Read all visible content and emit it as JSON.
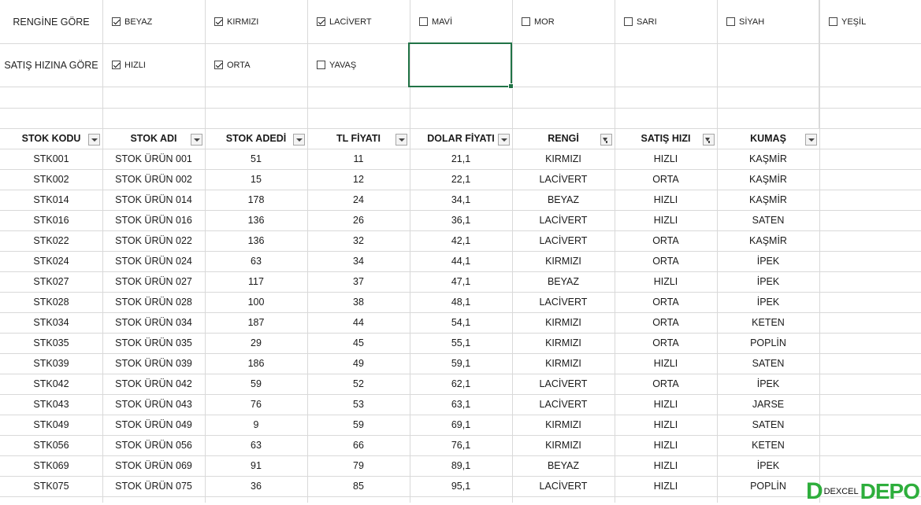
{
  "slicers": {
    "color": {
      "label": "RENGİNE GÖRE",
      "options": [
        {
          "label": "BEYAZ",
          "checked": true
        },
        {
          "label": "KIRMIZI",
          "checked": true
        },
        {
          "label": "LACİVERT",
          "checked": true
        },
        {
          "label": "MAVİ",
          "checked": false
        },
        {
          "label": "MOR",
          "checked": false
        },
        {
          "label": "SARI",
          "checked": false
        },
        {
          "label": "SİYAH",
          "checked": false
        },
        {
          "label": "YEŞİL",
          "checked": false
        }
      ]
    },
    "speed": {
      "label": "SATIŞ HIZINA GÖRE",
      "options": [
        {
          "label": "HIZLI",
          "checked": true
        },
        {
          "label": "ORTA",
          "checked": true
        },
        {
          "label": "YAVAŞ",
          "checked": false
        }
      ]
    }
  },
  "table": {
    "headers": [
      {
        "label": "STOK KODU",
        "filtered": false
      },
      {
        "label": "STOK ADI",
        "filtered": false
      },
      {
        "label": "STOK ADEDİ",
        "filtered": false
      },
      {
        "label": "TL FİYATI",
        "filtered": false
      },
      {
        "label": "DOLAR FİYATI",
        "filtered": false
      },
      {
        "label": "RENGİ",
        "filtered": true
      },
      {
        "label": "SATIŞ HIZI",
        "filtered": true
      },
      {
        "label": "KUMAŞ",
        "filtered": false
      }
    ],
    "rows": [
      [
        "STK001",
        "STOK ÜRÜN 001",
        "51",
        "11",
        "21,1",
        "KIRMIZI",
        "HIZLI",
        "KAŞMİR"
      ],
      [
        "STK002",
        "STOK ÜRÜN 002",
        "15",
        "12",
        "22,1",
        "LACİVERT",
        "ORTA",
        "KAŞMİR"
      ],
      [
        "STK014",
        "STOK ÜRÜN 014",
        "178",
        "24",
        "34,1",
        "BEYAZ",
        "HIZLI",
        "KAŞMİR"
      ],
      [
        "STK016",
        "STOK ÜRÜN 016",
        "136",
        "26",
        "36,1",
        "LACİVERT",
        "HIZLI",
        "SATEN"
      ],
      [
        "STK022",
        "STOK ÜRÜN 022",
        "136",
        "32",
        "42,1",
        "LACİVERT",
        "ORTA",
        "KAŞMİR"
      ],
      [
        "STK024",
        "STOK ÜRÜN 024",
        "63",
        "34",
        "44,1",
        "KIRMIZI",
        "ORTA",
        "İPEK"
      ],
      [
        "STK027",
        "STOK ÜRÜN 027",
        "117",
        "37",
        "47,1",
        "BEYAZ",
        "HIZLI",
        "İPEK"
      ],
      [
        "STK028",
        "STOK ÜRÜN 028",
        "100",
        "38",
        "48,1",
        "LACİVERT",
        "ORTA",
        "İPEK"
      ],
      [
        "STK034",
        "STOK ÜRÜN 034",
        "187",
        "44",
        "54,1",
        "KIRMIZI",
        "ORTA",
        "KETEN"
      ],
      [
        "STK035",
        "STOK ÜRÜN 035",
        "29",
        "45",
        "55,1",
        "KIRMIZI",
        "ORTA",
        "POPLİN"
      ],
      [
        "STK039",
        "STOK ÜRÜN 039",
        "186",
        "49",
        "59,1",
        "KIRMIZI",
        "HIZLI",
        "SATEN"
      ],
      [
        "STK042",
        "STOK ÜRÜN 042",
        "59",
        "52",
        "62,1",
        "LACİVERT",
        "ORTA",
        "İPEK"
      ],
      [
        "STK043",
        "STOK ÜRÜN 043",
        "76",
        "53",
        "63,1",
        "LACİVERT",
        "HIZLI",
        "JARSE"
      ],
      [
        "STK049",
        "STOK ÜRÜN 049",
        "9",
        "59",
        "69,1",
        "KIRMIZI",
        "HIZLI",
        "SATEN"
      ],
      [
        "STK056",
        "STOK ÜRÜN 056",
        "63",
        "66",
        "76,1",
        "KIRMIZI",
        "HIZLI",
        "KETEN"
      ],
      [
        "STK069",
        "STOK ÜRÜN 069",
        "91",
        "79",
        "89,1",
        "BEYAZ",
        "HIZLI",
        "İPEK"
      ],
      [
        "STK075",
        "STOK ÜRÜN 075",
        "36",
        "85",
        "95,1",
        "LACİVERT",
        "HIZLI",
        "POPLİN"
      ]
    ]
  },
  "watermark": {
    "text": "DEXCEL",
    "brand": "DEPO",
    "accent": "#2eae3c"
  },
  "colors": {
    "grid": "#d9d9d9",
    "selection": "#217346"
  }
}
